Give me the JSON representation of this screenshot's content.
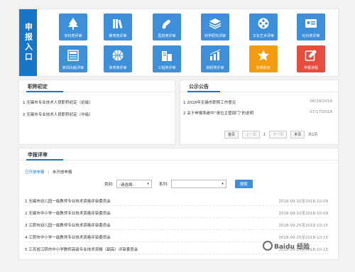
{
  "entry": {
    "title": "申报入口",
    "tiles": [
      {
        "label": "农科类评审",
        "icon": "tree-icon",
        "color": "blue"
      },
      {
        "label": "教育类评审",
        "icon": "books-icon",
        "color": "blue"
      },
      {
        "label": "医药类评审",
        "icon": "medicine-icon",
        "color": "blue"
      },
      {
        "label": "科学研究评审",
        "icon": "layers-icon",
        "color": "blue"
      },
      {
        "label": "文化艺术评审",
        "icon": "film-reel-icon",
        "color": "blue"
      },
      {
        "label": "社科类评审",
        "icon": "id-card-icon",
        "color": "blue"
      },
      {
        "label": "新闻出版评审",
        "icon": "newspaper-icon",
        "color": "blue"
      },
      {
        "label": "体育类评审",
        "icon": "basketball-icon",
        "color": "blue"
      },
      {
        "label": "工程类评审",
        "icon": "building-icon",
        "color": "blue"
      },
      {
        "label": "财经类评审",
        "icon": "chart-icon",
        "color": "blue"
      },
      {
        "label": "职称初定",
        "icon": "star-icon",
        "color": "orange"
      },
      {
        "label": "申报流程",
        "icon": "edit-icon",
        "color": "red"
      }
    ]
  },
  "review": {
    "title": "职称初定",
    "items": [
      "1 无锡市专业技术人员职称初定（初级）",
      "2 无锡市专业技术人员职称初定（中级）"
    ]
  },
  "notice": {
    "title": "公示公告",
    "items": [
      {
        "text": "1 2018年无锡市职称工作意见",
        "date": "06/29/2018"
      },
      {
        "text": "2 关于申报系统中“单位主管部门”的说明",
        "date": "07/17/2018"
      }
    ],
    "pager": {
      "first": "首页",
      "prev": "上一页",
      "current": "1",
      "next": "下一页",
      "last": "末页",
      "total": "共1页"
    }
  },
  "apply": {
    "title": "申报评审",
    "tab_open": "已开放申报",
    "tab_sep": "|",
    "tab_closed": "未开放申报",
    "category_label": "类别:",
    "category_value": "-请选择-",
    "series_label": "系列:",
    "series_value": "",
    "search_label": "搜索",
    "items": [
      {
        "text": "1 无锡市幼儿园一级教师专业技术资格评审委员会",
        "range": "2018-09-10至2018-10-09"
      },
      {
        "text": "2 无锡市中小学一级教师专业技术资格评审委员会",
        "range": "2018-09-10至2018-10-09"
      },
      {
        "text": "3 江阴市幼儿园一级教师专业技术资格评审委员会",
        "range": "2018-09-25至2018-10-15"
      },
      {
        "text": "4 江阴市中小学一级教师专业技术资格评审委员会",
        "range": "2018-09-25至2018-10-15"
      },
      {
        "text": "5 江苏省江阴市中小学教师高级专业技术资格（副高）评审委员会",
        "range": "2018-09-25至2018-10-15"
      }
    ]
  },
  "watermark": "Baidu 经验"
}
